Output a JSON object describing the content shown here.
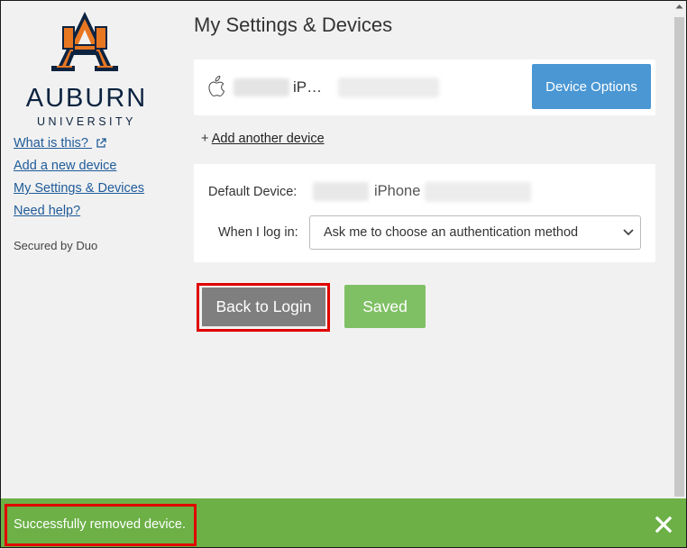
{
  "logo": {
    "wordmark": "AUBURN",
    "subtitle": "UNIVERSITY",
    "mark_letter": "A",
    "colors": {
      "navy": "#0c2340",
      "orange": "#e87722"
    }
  },
  "sidebar": {
    "links": [
      {
        "label": "What is this?",
        "icon": "external-link-icon"
      },
      {
        "label": "Add a new device"
      },
      {
        "label": "My Settings & Devices"
      },
      {
        "label": "Need help?"
      }
    ],
    "secured_by": "Secured by Duo"
  },
  "main": {
    "title": "My Settings & Devices",
    "device": {
      "icon": "apple-icon",
      "name": "iP…",
      "options_button": "Device Options"
    },
    "add_device": {
      "prefix": "+",
      "link": "Add another device"
    },
    "settings": {
      "default_label": "Default Device:",
      "default_value": "iPhone",
      "login_label": "When I log in:",
      "login_selected": "Ask me to choose an authentication method"
    },
    "buttons": {
      "back": "Back to Login",
      "saved": "Saved"
    }
  },
  "status": {
    "message": "Successfully removed device.",
    "close_icon": "close-icon"
  },
  "colors": {
    "primary_blue": "#4a97d4",
    "saved_green": "#80c065",
    "status_green": "#6cb046",
    "back_gray": "#7f7f7f",
    "highlight_red": "#e00000",
    "link_blue": "#1f5b9a"
  }
}
